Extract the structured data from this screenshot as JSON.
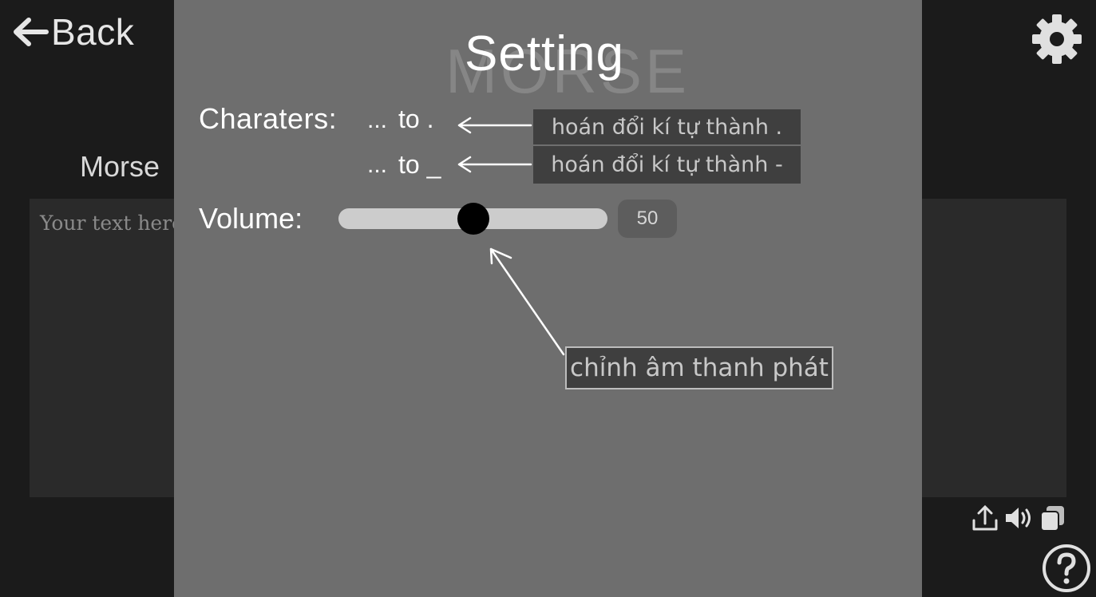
{
  "header": {
    "back_label": "Back"
  },
  "main": {
    "morse_label": "Morse",
    "input_placeholder": "Your text here..."
  },
  "settings": {
    "title": "Setting",
    "background_title": "MORSE",
    "characters_label": "Charaters:",
    "dot_mapping": {
      "prefix": "...",
      "target": "to ."
    },
    "dash_mapping": {
      "prefix": "...",
      "target": "to _"
    },
    "volume_label": "Volume:",
    "volume_value": "50",
    "volume_fraction": 0.5
  },
  "annotations": {
    "dot_note": "hoán đổi kí tự thành .",
    "dash_note": "hoán đổi kí tự thành -",
    "volume_note": "chỉnh âm thanh phát"
  },
  "icons": [
    "back-arrow-icon",
    "gear-icon",
    "upload-icon",
    "speaker-icon",
    "copy-icon",
    "help-icon"
  ],
  "colors": {
    "background": "#1b1b1b",
    "overlay": "#6e6e6e",
    "slider_track": "#cccccc",
    "slider_thumb": "#000000"
  }
}
